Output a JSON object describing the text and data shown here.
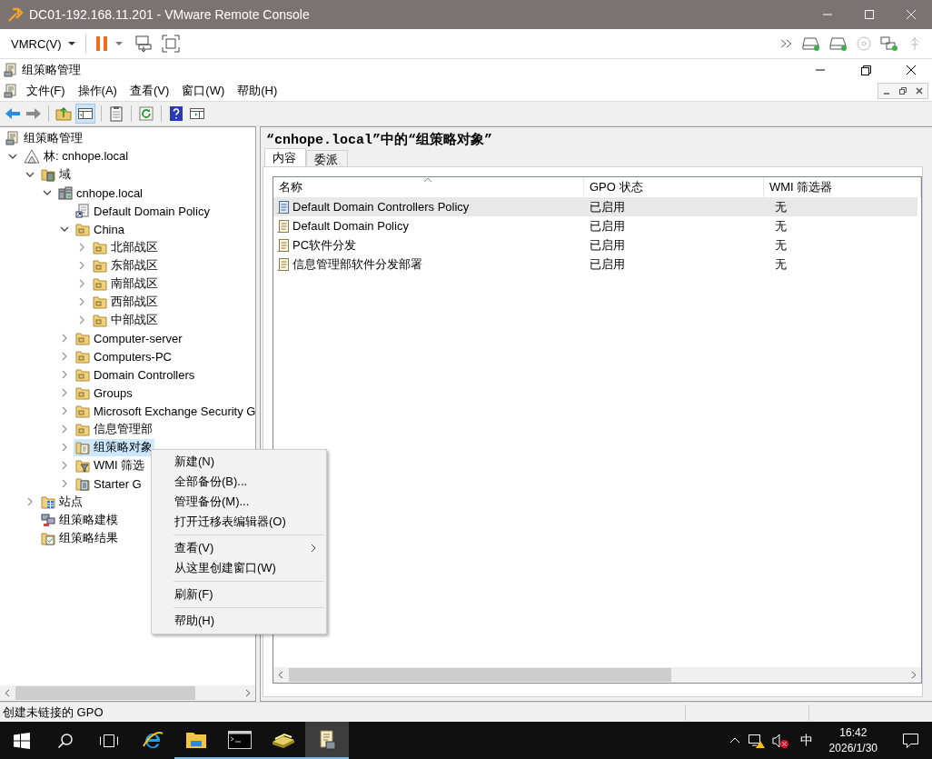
{
  "vm_window": {
    "title": "DC01-192.168.11.201 - VMware Remote Console"
  },
  "vm_toolbar": {
    "menu_label": "VMRC(V)"
  },
  "app_window": {
    "title": "组策略管理"
  },
  "menu_bar": [
    "文件(F)",
    "操作(A)",
    "查看(V)",
    "窗口(W)",
    "帮助(H)"
  ],
  "nav": {
    "back_disabled": false,
    "forward_disabled": true,
    "tree_toggle_on": true
  },
  "tree": {
    "label": "组策略管理",
    "kind": "root",
    "selected": false,
    "children": [
      {
        "label": "林: cnhope.local",
        "kind": "forest",
        "expandable": true,
        "expanded": true,
        "selected": false,
        "children": [
          {
            "label": "域",
            "kind": "domains",
            "expandable": true,
            "expanded": true,
            "selected": false,
            "children": [
              {
                "label": "cnhope.local",
                "kind": "domain",
                "expandable": true,
                "expanded": true,
                "selected": false,
                "children": [
                  {
                    "label": "Default Domain Policy",
                    "kind": "gpo-link",
                    "expandable": false,
                    "selected": false
                  },
                  {
                    "label": "China",
                    "kind": "ou",
                    "expandable": true,
                    "expanded": true,
                    "selected": false,
                    "children": [
                      {
                        "label": "北部战区",
                        "kind": "ou",
                        "expandable": true,
                        "expanded": false,
                        "selected": false
                      },
                      {
                        "label": "东部战区",
                        "kind": "ou",
                        "expandable": true,
                        "expanded": false,
                        "selected": false
                      },
                      {
                        "label": "南部战区",
                        "kind": "ou",
                        "expandable": true,
                        "expanded": false,
                        "selected": false
                      },
                      {
                        "label": "西部战区",
                        "kind": "ou",
                        "expandable": true,
                        "expanded": false,
                        "selected": false
                      },
                      {
                        "label": "中部战区",
                        "kind": "ou",
                        "expandable": true,
                        "expanded": false,
                        "selected": false
                      }
                    ]
                  },
                  {
                    "label": "Computer-server",
                    "kind": "ou",
                    "expandable": true,
                    "expanded": false,
                    "selected": false
                  },
                  {
                    "label": "Computers-PC",
                    "kind": "ou",
                    "expandable": true,
                    "expanded": false,
                    "selected": false
                  },
                  {
                    "label": "Domain Controllers",
                    "kind": "ou",
                    "expandable": true,
                    "expanded": false,
                    "selected": false
                  },
                  {
                    "label": "Groups",
                    "kind": "ou",
                    "expandable": true,
                    "expanded": false,
                    "selected": false
                  },
                  {
                    "label": "Microsoft Exchange Security G",
                    "kind": "ou",
                    "expandable": true,
                    "expanded": false,
                    "selected": false
                  },
                  {
                    "label": "信息管理部",
                    "kind": "ou",
                    "expandable": true,
                    "expanded": false,
                    "selected": false
                  },
                  {
                    "label": "组策略对象",
                    "kind": "gpo-folder",
                    "expandable": true,
                    "expanded": false,
                    "selected": true
                  },
                  {
                    "label": "WMI 筛选",
                    "kind": "wmi",
                    "expandable": true,
                    "expanded": false,
                    "selected": false
                  },
                  {
                    "label": "Starter G",
                    "kind": "starter",
                    "expandable": true,
                    "expanded": false,
                    "selected": false
                  }
                ]
              }
            ]
          },
          {
            "label": "站点",
            "kind": "sites",
            "expandable": true,
            "expanded": false,
            "selected": false
          },
          {
            "label": "组策略建模",
            "kind": "modeling",
            "expandable": false,
            "selected": false
          },
          {
            "label": "组策略结果",
            "kind": "results",
            "expandable": false,
            "selected": false
          }
        ]
      }
    ]
  },
  "context_menu": {
    "groups": [
      [
        {
          "label": "新建(N)",
          "submenu": false
        },
        {
          "label": "全部备份(B)...",
          "submenu": false
        },
        {
          "label": "管理备份(M)...",
          "submenu": false
        },
        {
          "label": "打开迁移表编辑器(O)",
          "submenu": false
        }
      ],
      [
        {
          "label": "查看(V)",
          "submenu": true
        },
        {
          "label": "从这里创建窗口(W)",
          "submenu": false
        }
      ],
      [
        {
          "label": "刷新(F)",
          "submenu": false
        }
      ],
      [
        {
          "label": "帮助(H)",
          "submenu": false
        }
      ]
    ]
  },
  "details": {
    "heading": "“cnhope.local”中的“组策略对象”",
    "tabs": [
      {
        "label": "内容",
        "selected": true
      },
      {
        "label": "委派",
        "selected": false
      }
    ],
    "columns": [
      {
        "label": "名称",
        "sorted": true
      },
      {
        "label": "GPO 状态",
        "sorted": false
      },
      {
        "label": "WMI 筛选器",
        "sorted": false
      }
    ],
    "rows": [
      {
        "cells": [
          "Default Domain Controllers Policy",
          "已启用",
          "无"
        ],
        "selected": true
      },
      {
        "cells": [
          "Default Domain Policy",
          "已启用",
          "无"
        ],
        "selected": false
      },
      {
        "cells": [
          "PC软件分发",
          "已启用",
          "无"
        ],
        "selected": false
      },
      {
        "cells": [
          "信息管理部软件分发部署",
          "已启用",
          "无"
        ],
        "selected": false
      }
    ]
  },
  "status_bar": {
    "text": "创建未链接的 GPO"
  },
  "taskbar": {
    "apps": [
      {
        "kind": "start",
        "running": false,
        "active": false
      },
      {
        "kind": "search",
        "running": false,
        "active": false
      },
      {
        "kind": "task-view",
        "running": false,
        "active": false
      },
      {
        "kind": "browser",
        "running": false,
        "active": false
      },
      {
        "kind": "file-explorer",
        "running": true,
        "active": false
      },
      {
        "kind": "terminal",
        "running": true,
        "active": false
      },
      {
        "kind": "stack",
        "running": true,
        "active": false
      },
      {
        "kind": "gpmc",
        "running": true,
        "active": true
      }
    ],
    "network_alert": true,
    "volume_muted": true,
    "ime": "中",
    "time": "16:42",
    "date": "2026/1/30"
  }
}
